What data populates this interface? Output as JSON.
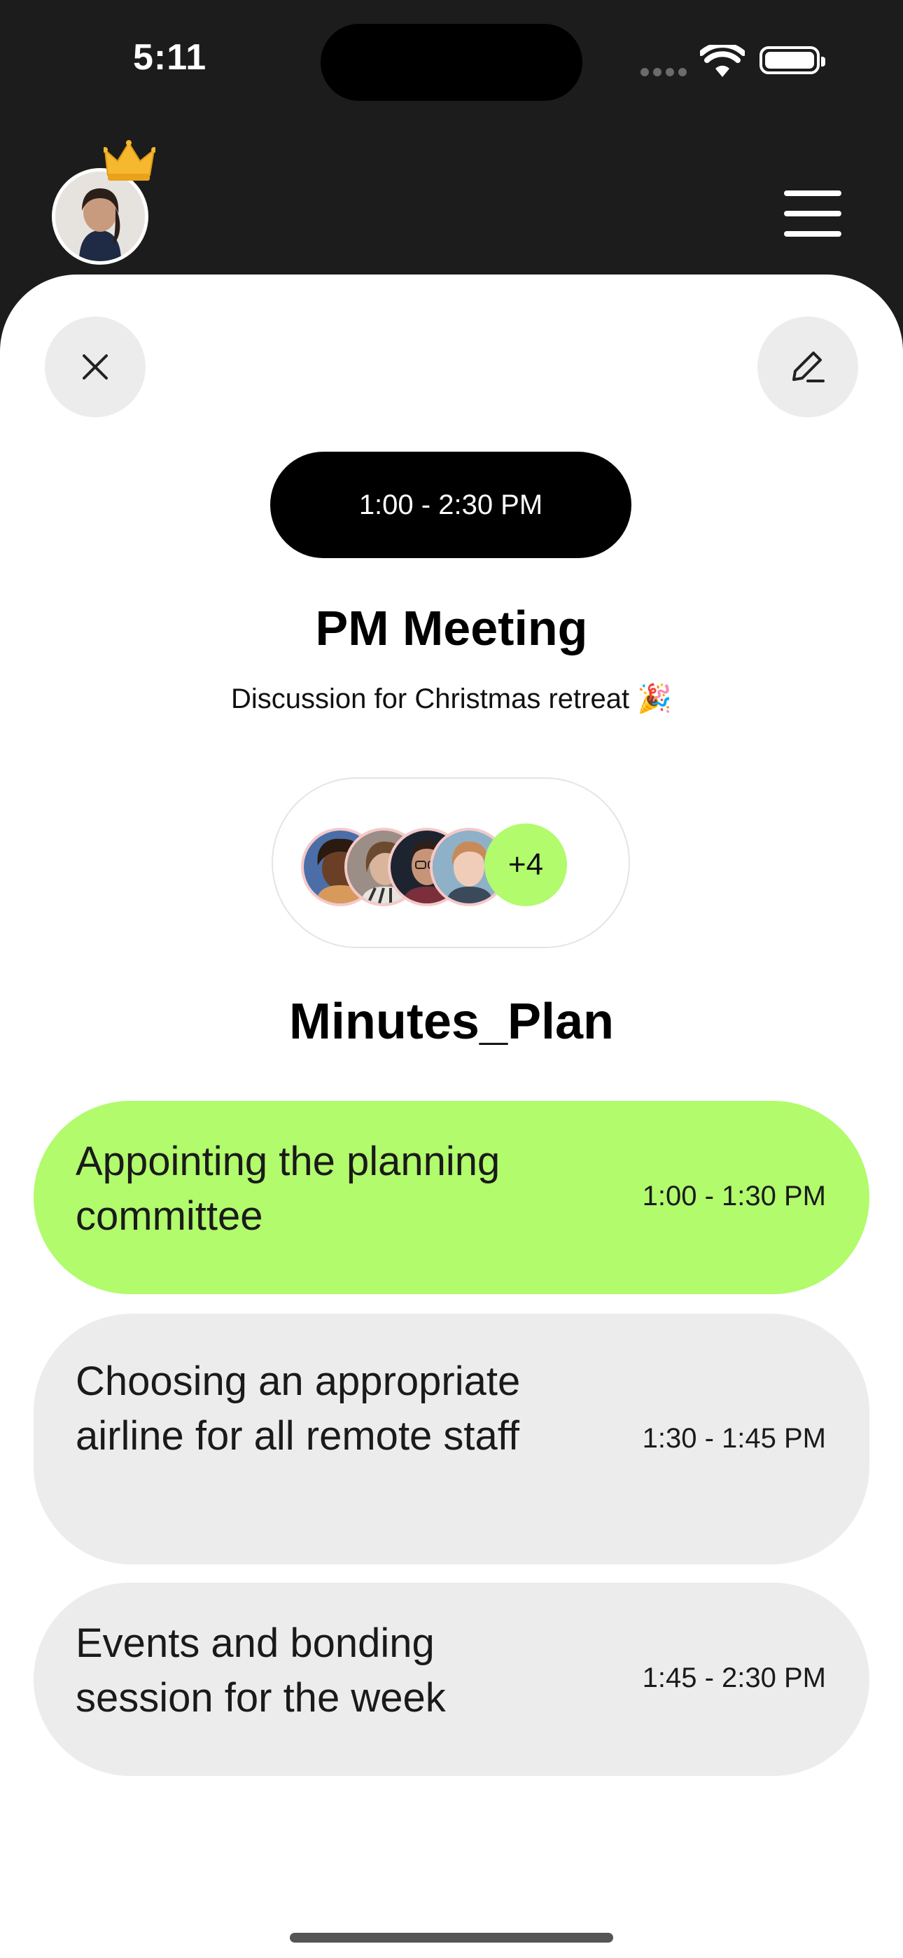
{
  "status_bar": {
    "time": "5:11"
  },
  "event": {
    "time_range": "1:00 - 2:30 PM",
    "title": "PM Meeting",
    "subtitle": "Discussion for Christmas retreat 🎉"
  },
  "attendees": {
    "more_count": "+4"
  },
  "minutes": {
    "title": "Minutes_Plan",
    "items": [
      {
        "label": "Appointing the planning committee",
        "time": "1:00 - 1:30 PM",
        "active": true
      },
      {
        "label": "Choosing an appropriate airline for all remote staff",
        "time": "1:30 - 1:45 PM",
        "active": false
      },
      {
        "label": "Events and bonding session for the week",
        "time": "1:45 - 2:30 PM",
        "active": false
      }
    ]
  },
  "colors": {
    "accent_green": "#b1fb6c",
    "header_bg": "#1c1c1c",
    "item_bg": "#ececec"
  },
  "icons": [
    "crown-icon",
    "menu-icon",
    "close-icon",
    "edit-icon",
    "wifi-icon",
    "battery-icon"
  ]
}
